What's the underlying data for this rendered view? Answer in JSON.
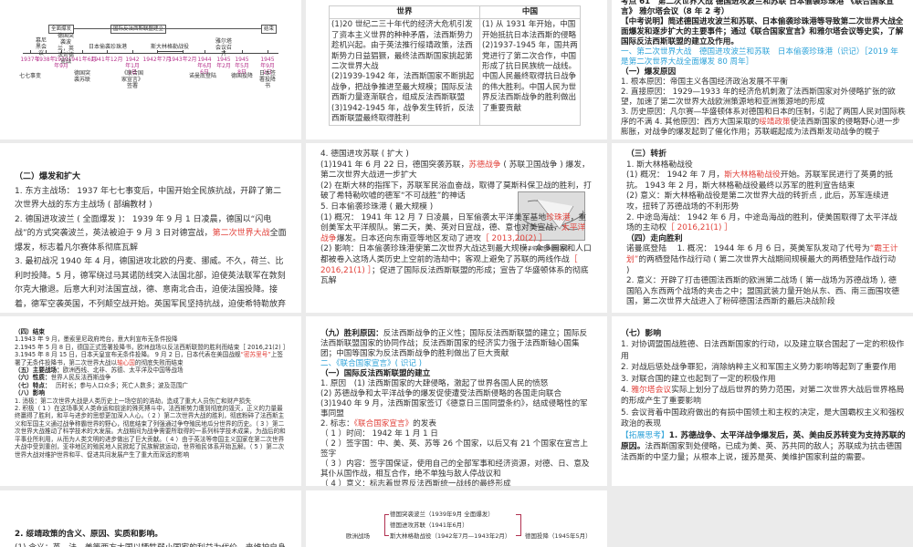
{
  "timeline": {
    "top_boxes": [
      "全面爆发",
      "国际反法西斯联盟建立",
      "结束"
    ],
    "dates": [
      "1937年",
      "1938年",
      "1939年9月",
      "1941年6月",
      "1941年12月",
      "1942年1月1日",
      "1942年7月",
      "1943年2月",
      "1944年6月6日",
      "1945年2月",
      "1945年5月8日",
      "1945年9月2日"
    ],
    "upper_events": [
      "慕尼黑会议",
      "德国突袭波兰，英法对德宣战",
      "日本偷袭珍珠港",
      "斯大林格勒战役",
      "雅尔塔会议召开"
    ],
    "lower_events": [
      "七七事变",
      "德国突袭苏联",
      "《联合国家宣言》签署",
      "诺曼底登陆",
      "德国投降",
      "日本签署投降书"
    ]
  },
  "table": {
    "headers": [
      "世界",
      "中国"
    ],
    "world": [
      "(1)20 世纪二三十年代的经济大危机引发了资本主义世界的种种矛盾，法西斯势力趁机兴起。由于英法推行绥靖政策，法西斯势力日益猖獗，最终法西斯国家挑起第二次世界大战",
      "(2)1939-1942 年，法西斯国家不断挑起战争，把战争推进至最大规模；国际反法西斯力量逐渐联合，组成反法西斯联盟",
      "(3)1942-1945 年，战争发生转折，反法西斯联盟最终取得胜利"
    ],
    "china": [
      "(1) 从 1931 年开始，中国开始抵抗日本法西斯的侵略",
      "(2)1937-1945 年，国共两党进行了第二次合作，中国形成了抗日民族统一战线。中国人民最终取得抗日战争的伟大胜利。中国人民为世界反法西斯战争的胜利做出了重要贡献"
    ]
  },
  "p3": [
    [
      {
        "t": "考点 61　第二次世界大战  德国进攻波兰和苏联  日本偷袭珍珠港 《联合国家宣言》 雅尔塔会议（8 年 2 考）",
        "c": "bold"
      }
    ],
    [
      {
        "t": "【中考说明】简述德国进攻波兰和苏联、日本偷袭珍珠港等导致第二次世界大战全面爆发和逐步扩大的主要事件；通过《联合国家宣言》和雅尔塔会议等史实，了解国际反法西斯联盟的建立及作用。",
        "c": "bold"
      }
    ],
    [
      {
        "t": "一、第二次世界大战　德国进攻波兰和苏联　日本偷袭珍珠港（识记）［2019 年是第二次世界大战全面爆发 80 周年］",
        "c": "b"
      }
    ],
    [
      {
        "t": "（一）爆发原因",
        "c": "bold"
      }
    ],
    [
      {
        "t": "1. 根本原因：帝国主义各国经济政治发展不平衡"
      }
    ],
    [
      {
        "t": "2. 直接原因： 1929—1933 年的经济危机刺激了法西斯国家对外侵略扩张的欲望，加速了第二次世界大战欧洲策源地和亚洲策源地的形成"
      }
    ],
    [
      {
        "t": "3. 历史原因：凡尔赛—华盛顿体系对德国和日本的压制，引起了两国人民对国际秩序的不满 4. 其他原因：西方大国采取的"
      },
      {
        "t": "绥靖政策",
        "c": "r"
      },
      {
        "t": "使法西斯国家的侵略野心进一步膨胀，对战争的爆发起到了催化作用；苏联崛起成为法西斯发动战争的幌子"
      }
    ]
  ],
  "p4": [
    [
      {
        "t": "（二）爆发和扩大",
        "c": "bold"
      }
    ],
    [
      {
        "t": "1. 东方主战场： 1937 年七七事变后，中国开始全民族抗战，开辟了第二次世界大战的东方主战场 ( 部编教材 )"
      }
    ],
    [
      {
        "t": "2. 德国进攻波兰 ( 全面爆发 )： 1939 年 9 月 1 日凌晨，德国以“闪电战”的方式突袭波兰，英法被迫于 9 月 3 日对德宣战，"
      },
      {
        "t": "第二次世界大战",
        "c": "r"
      },
      {
        "t": "全面爆发，标志着凡尔赛体系彻底瓦解"
      }
    ],
    [
      {
        "t": "3. 最初战况 1940 年 4 月，德国进攻北欧的丹麦、挪威。不久，荷兰、比利时投降。5 月，德军绕过马其诺防线突入法国北部，迫使英法联军在敦刻尔克大撤退。后意大利对法国宣战，德、意南北合击，迫使法国投降。接着，德军空袭英国，不列颠空战开始。英国军民坚持抗战，迫使希特勒放弃了进攻英国的计划"
      }
    ]
  ],
  "p5": [
    [
      {
        "t": "4. 德国进攻苏联 ( 扩大 )"
      }
    ],
    [
      {
        "t": "(1)1941 年 6 月 22 日，德国突袭苏联，"
      },
      {
        "t": "苏德战争",
        "c": "r"
      },
      {
        "t": " ( 苏联卫国战争 ) 爆发，第二次世界大战进一步扩大"
      }
    ],
    [
      {
        "t": "(2) 在斯大林的指挥下，苏联军民浴血奋战，取得了莫斯科保卫战的胜利，打破了希特勒吹嘘的德军“不可战胜”的神话"
      }
    ],
    [
      {
        "t": "5. 日本偷袭珍珠港 ( 最大规模 )"
      }
    ],
    [
      {
        "t": "(1) 概况： 1941 年 12 月 7 日凌晨，日军偷袭太平洋美军基地"
      },
      {
        "t": "珍珠港",
        "c": "r"
      },
      {
        "t": "，重创美军太平洋舰队。第二天，美、英对日宣战，德、意也对美宣战，"
      },
      {
        "t": "太平洋战争",
        "c": "r"
      },
      {
        "t": "爆发。日本还向东南亚等地区发动了进攻"
      },
      {
        "t": "［ 2013,20(2) ］",
        "c": "r"
      }
    ],
    [
      {
        "t": "(2) 影响：日本偷袭珍珠港使第二次世界大战达到最大规模，众多国家和人口都被卷入这场人类历史上空前的浩劫中；客观上避免了苏联的两线作战"
      },
      {
        "t": "［ 2016,21(1) ］",
        "c": "r"
      },
      {
        "t": "；促进了国际反法西斯联盟的形成；宣告了华盛顿体系的彻底瓦解"
      }
    ]
  ],
  "map_caption": "日本偷袭珍珠港示意图",
  "p6": [
    [
      {
        "t": "（三）转折",
        "c": "bold"
      }
    ],
    [
      {
        "t": "1. 斯大林格勒战役"
      }
    ],
    [
      {
        "t": "(1) 概况： 1942 年 7 月，"
      },
      {
        "t": "斯大林格勒战役",
        "c": "r"
      },
      {
        "t": "开始。苏联军民进行了英勇的抵抗。 1943 年 2 月，斯大林格勒战役最终以苏军的胜利宣告结束"
      }
    ],
    [
      {
        "t": "(2) 意义：斯大林格勒战役是第二次世界大战的转折点 , 此后，苏军连续进攻，扭转了苏德战场的不利形势"
      }
    ],
    [
      {
        "t": "2. 中途岛海战： 1942 年 6 月，中途岛海战的胜利，使美国取得了太平洋战场的主动权"
      },
      {
        "t": "［ 2016,21(1) ］",
        "c": "r"
      }
    ],
    [
      {
        "t": "（四）走向胜利",
        "c": "bold"
      }
    ],
    [
      {
        "t": "诺曼底登陆　 1. 概况： 1944 年 6 月 6 日，英美军队发动了代号为"
      },
      {
        "t": "“霸王计划”",
        "c": "r"
      },
      {
        "t": "的两栖登陆作战行动 ( 第二次世界大战期间规模最大的两栖登陆作战行动 )"
      }
    ],
    [
      {
        "t": "2. 意义：开辟了打击德国法西斯的欧洲第二战场 ( 第一战场为苏德战场 ), 德国陷入东西两个战场的夹击之中；盟国武装力量开始从东、西、南三面围攻德国，第二次世界大战进入了粉碎德国法西斯的最后决战阶段"
      }
    ]
  ],
  "p7": [
    [
      {
        "t": "（四）结束",
        "c": "bold"
      }
    ],
    [
      {
        "t": "1.1943 年 9 月，墨索里尼政府垮台，意大利宣布无条件投降"
      }
    ],
    [
      {
        "t": "2.1945 年 5 月 8 日，德国正式签署投降书，欧洲战场以反法西斯联盟的胜利而结束［ 2016,21(2) ］"
      }
    ],
    [
      {
        "t": "3.1945 年 8 月 15 日，日本天皇宣布无条件投降。 9 月 2 日，日本代表在美国战舰"
      },
      {
        "t": "“密苏里号”",
        "c": "r"
      },
      {
        "t": "上签署了无条件投降书，第二次世界大战以"
      },
      {
        "t": "轴心国",
        "c": "r"
      },
      {
        "t": "的彻底失败而结束"
      }
    ],
    [
      {
        "t": "（五）主要战场：",
        "c": "bold"
      },
      {
        "t": "欧洲西线、北非、苏德、太平洋及中国等战场"
      }
    ],
    [
      {
        "t": "（六）性质：",
        "c": "bold"
      },
      {
        "t": "世界人民反法西斯战争"
      }
    ],
    [
      {
        "t": "（七）特点：",
        "c": "bold"
      },
      {
        "t": "　 历时长；参与人口众多；死亡人数多；波及范围广"
      }
    ],
    [
      {
        "t": "（八）影响",
        "c": "bold"
      }
    ],
    [
      {
        "t": "1. 消极：第二次世界大战是人类历史上一场空前的浩劫，造成了重大人员伤亡和财产损失"
      }
    ],
    [
      {
        "t": "2. 积极（ 1 ）在这场事关人类命运和前途的殊死搏斗中，法西斯势力遭到彻底的毁灭，正义的力量最终赢得了胜利，和平与进步的思想更加深入人心。（ 2 ）第二次世界大战的胜利，彻底粉碎了法西斯主义和军国主义通过战争称霸世界的野心，彻底结束了列强通过争夺殖民地瓜分世界的历史。（ 3 ）第二次世界大战推动了科学技术的大发展。大战期间为战争需要所取得的一系列科学技术成果，为战后的和平事业所利用，从而为人类文明的进步做出了巨大贡献。（ 4 ）由于英法等帝国主义国家在第二次世界大战中受到重创，亚非地区的殖民地人民掀起了民族解放运动，世界殖民体系开始瓦解。（ 5 ）第二次世界大战对维护世界和平、促进共同发展产生了重大而深远的影响"
      }
    ]
  ],
  "p8": [
    [
      {
        "t": "（九）胜利原因：",
        "c": "bold"
      },
      {
        "t": "反法西斯战争的正义性；国际反法西斯联盟的建立；国际反法西斯联盟国家的协同作战；反法西斯国家的经济实力强于法西斯轴心国集团；中国等国家为反法西斯战争的胜利做出了巨大贡献"
      }
    ],
    [
      {
        "t": "二、《联合国家宣言》( 识记 )",
        "c": "b"
      }
    ],
    [
      {
        "t": "（一）国际反法西斯联盟的建立",
        "c": "bold"
      }
    ],
    [
      {
        "t": "1. 原因　(1) 法西斯国家的大肆侵略，激起了世界各国人民的愤怒"
      }
    ],
    [
      {
        "t": "(2) 苏德战争和太平洋战争的爆发促使遭受法西斯侵略的各国走向联合"
      }
    ],
    [
      {
        "t": "(3)1940 年 9 月，法西斯国家签订《德意日三国同盟条约》，结成侵略性的军事同盟"
      }
    ],
    [
      {
        "t": "2. 标志："
      },
      {
        "t": "《联合国家宣言》",
        "c": "r"
      },
      {
        "t": "的发表"
      }
    ],
    [
      {
        "t": "（ 1 ）时间： 1942 年 1 月 1 日"
      }
    ],
    [
      {
        "t": "（ 2 ）签字国：中、美、英、苏等 26 个国家，以后又有 21 个国家在宣言上签字"
      }
    ],
    [
      {
        "t": "（ 3 ）内容：签字国保证，使用自己的全部军事和经济资源，对德、日、意及其仆从国作战，相互合作，绝不单独与敌人停战议和"
      }
    ],
    [
      {
        "t": "（ 4 ）意义：标志着世界反法西斯统一战线的最终形成"
      }
    ]
  ],
  "p9": [
    [
      {
        "t": "（七）影响",
        "c": "bold"
      }
    ],
    [
      {
        "t": "1. 对协调盟国战胜德、日法西斯国家的行动，以及建立联合国起了一定的积极作用"
      }
    ],
    [
      {
        "t": "2. 对战后惩处战争罪犯，消除纳粹主义和军国主义势力影响等起到了重要作用"
      }
    ],
    [
      {
        "t": "3. 对联合国的建立也起到了一定的积极作用"
      }
    ],
    [
      {
        "t": "4. "
      },
      {
        "t": "雅尔塔会议",
        "c": "r"
      },
      {
        "t": "实际上划分了战后世界的势力范围，对第二次世界大战后世界格局的形成产生了重要影响"
      }
    ],
    [
      {
        "t": "5. 会议背着中国政府做出的有损中国领土和主权的决定，是大国霸权主义和强权政治的表现"
      }
    ],
    [
      {
        "t": " "
      }
    ],
    [
      {
        "t": "【拓展思考】",
        "c": "b"
      },
      {
        "t": "1. 苏德战争、太平洋战争爆发后，英、美由反苏转变为支持苏联的原因。",
        "c": "bold"
      },
      {
        "t": "法西斯国家到处侵略，已成为美、英、苏共同的敌人；苏联成为抗击德国法西斯的中坚力量；从根本上说，援苏是英、美维护国家利益的需要。"
      }
    ]
  ],
  "p10": [
    [
      {
        "t": "2. 绥靖政策的含义、原因、实质和影响。",
        "c": "bold"
      }
    ],
    [
      {
        "t": "(1) 含义：英、法、美等西方大国以牺牲弱小国家的利益为代价，来维护自身的利"
      }
    ]
  ],
  "diagram": {
    "nodes": [
      "德国突袭波兰（1939年9月 全面爆发）",
      "德国进攻苏联（1941年6月）",
      "斯大林格勒战役（1942年7月—1943年2月）",
      "德国投降（1945年5月）"
    ],
    "left": "欧洲战场"
  }
}
